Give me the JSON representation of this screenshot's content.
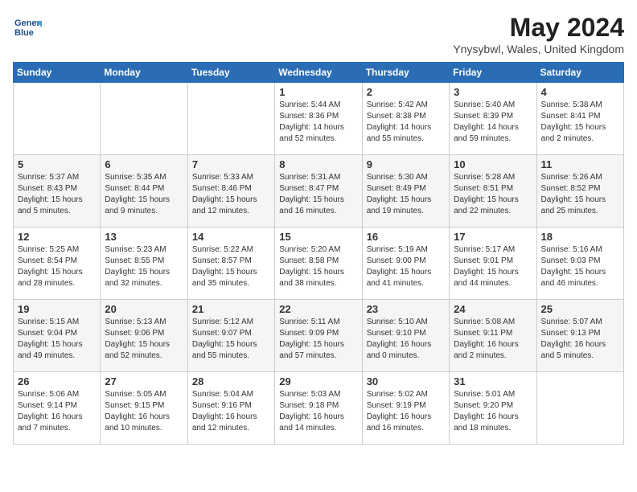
{
  "header": {
    "logo_line1": "General",
    "logo_line2": "Blue",
    "title": "May 2024",
    "subtitle": "Ynysybwl, Wales, United Kingdom"
  },
  "weekdays": [
    "Sunday",
    "Monday",
    "Tuesday",
    "Wednesday",
    "Thursday",
    "Friday",
    "Saturday"
  ],
  "weeks": [
    [
      {
        "day": "",
        "info": ""
      },
      {
        "day": "",
        "info": ""
      },
      {
        "day": "",
        "info": ""
      },
      {
        "day": "1",
        "info": "Sunrise: 5:44 AM\nSunset: 8:36 PM\nDaylight: 14 hours\nand 52 minutes."
      },
      {
        "day": "2",
        "info": "Sunrise: 5:42 AM\nSunset: 8:38 PM\nDaylight: 14 hours\nand 55 minutes."
      },
      {
        "day": "3",
        "info": "Sunrise: 5:40 AM\nSunset: 8:39 PM\nDaylight: 14 hours\nand 59 minutes."
      },
      {
        "day": "4",
        "info": "Sunrise: 5:38 AM\nSunset: 8:41 PM\nDaylight: 15 hours\nand 2 minutes."
      }
    ],
    [
      {
        "day": "5",
        "info": "Sunrise: 5:37 AM\nSunset: 8:43 PM\nDaylight: 15 hours\nand 5 minutes."
      },
      {
        "day": "6",
        "info": "Sunrise: 5:35 AM\nSunset: 8:44 PM\nDaylight: 15 hours\nand 9 minutes."
      },
      {
        "day": "7",
        "info": "Sunrise: 5:33 AM\nSunset: 8:46 PM\nDaylight: 15 hours\nand 12 minutes."
      },
      {
        "day": "8",
        "info": "Sunrise: 5:31 AM\nSunset: 8:47 PM\nDaylight: 15 hours\nand 16 minutes."
      },
      {
        "day": "9",
        "info": "Sunrise: 5:30 AM\nSunset: 8:49 PM\nDaylight: 15 hours\nand 19 minutes."
      },
      {
        "day": "10",
        "info": "Sunrise: 5:28 AM\nSunset: 8:51 PM\nDaylight: 15 hours\nand 22 minutes."
      },
      {
        "day": "11",
        "info": "Sunrise: 5:26 AM\nSunset: 8:52 PM\nDaylight: 15 hours\nand 25 minutes."
      }
    ],
    [
      {
        "day": "12",
        "info": "Sunrise: 5:25 AM\nSunset: 8:54 PM\nDaylight: 15 hours\nand 28 minutes."
      },
      {
        "day": "13",
        "info": "Sunrise: 5:23 AM\nSunset: 8:55 PM\nDaylight: 15 hours\nand 32 minutes."
      },
      {
        "day": "14",
        "info": "Sunrise: 5:22 AM\nSunset: 8:57 PM\nDaylight: 15 hours\nand 35 minutes."
      },
      {
        "day": "15",
        "info": "Sunrise: 5:20 AM\nSunset: 8:58 PM\nDaylight: 15 hours\nand 38 minutes."
      },
      {
        "day": "16",
        "info": "Sunrise: 5:19 AM\nSunset: 9:00 PM\nDaylight: 15 hours\nand 41 minutes."
      },
      {
        "day": "17",
        "info": "Sunrise: 5:17 AM\nSunset: 9:01 PM\nDaylight: 15 hours\nand 44 minutes."
      },
      {
        "day": "18",
        "info": "Sunrise: 5:16 AM\nSunset: 9:03 PM\nDaylight: 15 hours\nand 46 minutes."
      }
    ],
    [
      {
        "day": "19",
        "info": "Sunrise: 5:15 AM\nSunset: 9:04 PM\nDaylight: 15 hours\nand 49 minutes."
      },
      {
        "day": "20",
        "info": "Sunrise: 5:13 AM\nSunset: 9:06 PM\nDaylight: 15 hours\nand 52 minutes."
      },
      {
        "day": "21",
        "info": "Sunrise: 5:12 AM\nSunset: 9:07 PM\nDaylight: 15 hours\nand 55 minutes."
      },
      {
        "day": "22",
        "info": "Sunrise: 5:11 AM\nSunset: 9:09 PM\nDaylight: 15 hours\nand 57 minutes."
      },
      {
        "day": "23",
        "info": "Sunrise: 5:10 AM\nSunset: 9:10 PM\nDaylight: 16 hours\nand 0 minutes."
      },
      {
        "day": "24",
        "info": "Sunrise: 5:08 AM\nSunset: 9:11 PM\nDaylight: 16 hours\nand 2 minutes."
      },
      {
        "day": "25",
        "info": "Sunrise: 5:07 AM\nSunset: 9:13 PM\nDaylight: 16 hours\nand 5 minutes."
      }
    ],
    [
      {
        "day": "26",
        "info": "Sunrise: 5:06 AM\nSunset: 9:14 PM\nDaylight: 16 hours\nand 7 minutes."
      },
      {
        "day": "27",
        "info": "Sunrise: 5:05 AM\nSunset: 9:15 PM\nDaylight: 16 hours\nand 10 minutes."
      },
      {
        "day": "28",
        "info": "Sunrise: 5:04 AM\nSunset: 9:16 PM\nDaylight: 16 hours\nand 12 minutes."
      },
      {
        "day": "29",
        "info": "Sunrise: 5:03 AM\nSunset: 9:18 PM\nDaylight: 16 hours\nand 14 minutes."
      },
      {
        "day": "30",
        "info": "Sunrise: 5:02 AM\nSunset: 9:19 PM\nDaylight: 16 hours\nand 16 minutes."
      },
      {
        "day": "31",
        "info": "Sunrise: 5:01 AM\nSunset: 9:20 PM\nDaylight: 16 hours\nand 18 minutes."
      },
      {
        "day": "",
        "info": ""
      }
    ]
  ]
}
